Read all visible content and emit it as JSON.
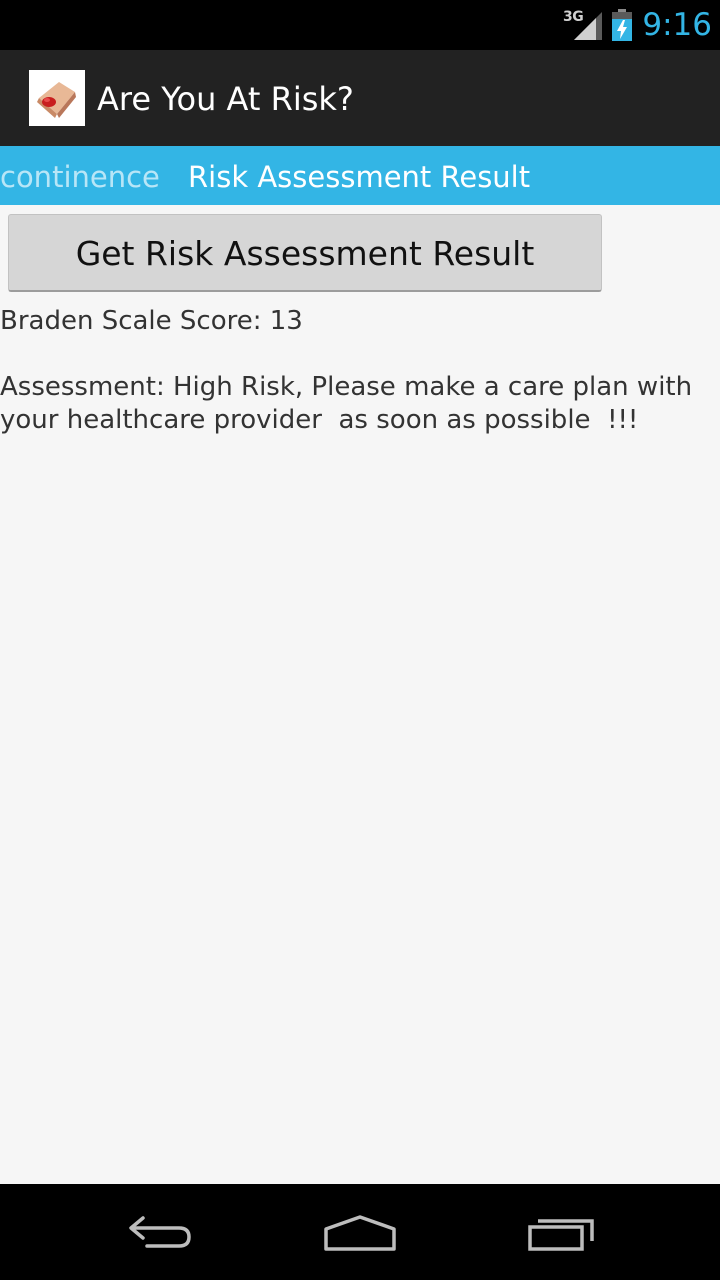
{
  "status_bar": {
    "network": "3G",
    "time": "9:16",
    "icons": [
      "signal-icon",
      "battery-charging-icon"
    ],
    "accent_color": "#33b5e5"
  },
  "action_bar": {
    "icon": "app-logo-icon",
    "title": "Are You At Risk?"
  },
  "tabs": {
    "previous_label": "continence",
    "current_label": "Risk Assessment Result",
    "strip_color": "#33b5e5"
  },
  "main": {
    "button_label": "Get Risk Assessment Result",
    "score_text": "Braden Scale Score: 13",
    "assessment_text": "Assessment: High Risk, Please make a care plan with your healthcare provider  as soon as possible  !!!"
  },
  "nav_bar": {
    "icons": [
      "back-icon",
      "home-icon",
      "recent-apps-icon"
    ]
  }
}
